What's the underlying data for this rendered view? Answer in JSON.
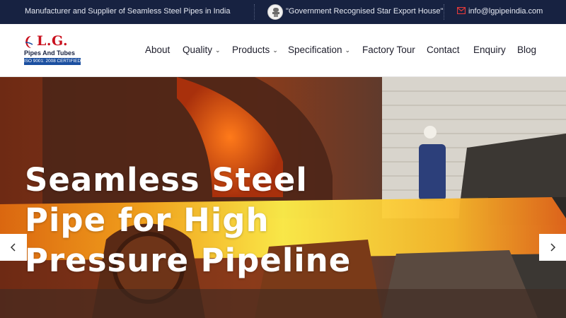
{
  "topbar": {
    "tagline": "Manufacturer and Supplier of Seamless Steel Pipes in India",
    "export_house": "\"Government Recognised Star Export House\"",
    "email": "info@lgpipeindia.com",
    "emblem_icon": "government-emblem-icon",
    "email_icon": "envelope-icon",
    "background": "#172241"
  },
  "logo": {
    "letters": "L.G.",
    "subtitle": "Pipes And Tubes",
    "certification": "ISO 9001: 2008 CERTIFIED",
    "brand_red": "#c9111e",
    "brand_blue": "#1b4fa0"
  },
  "nav": {
    "items": [
      {
        "label": "About",
        "dropdown": false
      },
      {
        "label": "Quality",
        "dropdown": true
      },
      {
        "label": "Products",
        "dropdown": true
      },
      {
        "label": "Specification",
        "dropdown": true
      },
      {
        "label": "Factory Tour",
        "dropdown": false
      },
      {
        "label": "Contact",
        "dropdown": false
      },
      {
        "label": "Enquiry",
        "dropdown": false
      },
      {
        "label": "Blog",
        "dropdown": false
      }
    ]
  },
  "hero": {
    "title_line1": "Seamless Steel",
    "title_line2": "Pipe for High",
    "title_line3": "Pressure Pipeline",
    "prev_icon": "chevron-left-icon",
    "next_icon": "chevron-right-icon"
  }
}
